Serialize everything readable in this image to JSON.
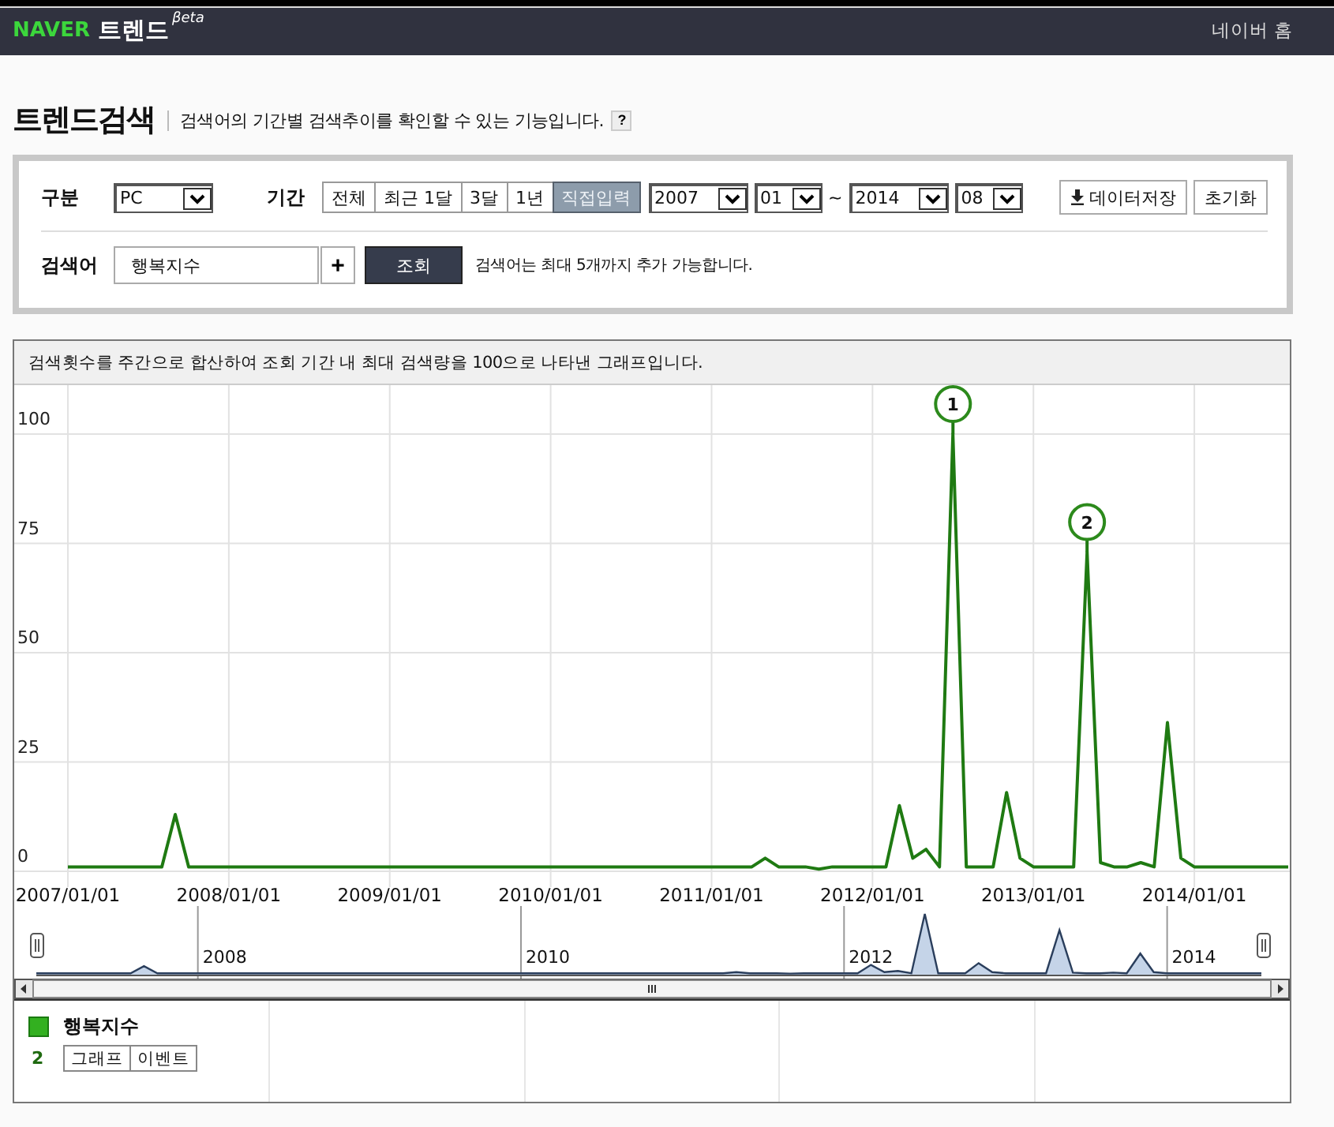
{
  "header": {
    "logo": "NAVER",
    "title": "트렌드",
    "superscript": "βeta",
    "home_link": "네이버 홈"
  },
  "page": {
    "title": "트렌드검색",
    "description": "검색어의 기간별 검색추이를 확인할 수 있는 기능입니다.",
    "help": "?"
  },
  "filters": {
    "category_label": "구분",
    "category": "PC",
    "period_label": "기간",
    "period_tabs": [
      {
        "label": "전체",
        "selected": false
      },
      {
        "label": "최근 1달",
        "selected": false
      },
      {
        "label": "3달",
        "selected": false
      },
      {
        "label": "1년",
        "selected": false
      },
      {
        "label": "직접입력",
        "selected": true
      }
    ],
    "start_year": "2007",
    "start_month": "01",
    "separator": "~",
    "end_year": "2014",
    "end_month": "08",
    "buttons": [
      {
        "kind": "download",
        "label": "데이터저장"
      },
      {
        "kind": "plain",
        "label": "초기화"
      }
    ],
    "keyword_label": "검색어",
    "keyword": "행복지수",
    "add_button": "+",
    "search_button": "조회",
    "hint": "검색어는 최대 5개까지 추가 가능합니다."
  },
  "chart": {
    "caption": "검색횟수를 주간으로 합산하여 조회 기간 내 최대 검색량을 100으로 나타낸 그래프입니다.",
    "chart_data": {
      "type": "line",
      "grid": true,
      "ylim": [
        0,
        100
      ],
      "yticks": [
        0,
        25,
        50,
        75,
        100
      ],
      "categories": [
        "2007/01/01",
        null,
        null,
        null,
        null,
        null,
        null,
        null,
        null,
        null,
        null,
        null,
        "2008/01/01",
        null,
        null,
        null,
        null,
        null,
        null,
        null,
        null,
        null,
        null,
        null,
        "2009/01/01",
        null,
        null,
        null,
        null,
        null,
        null,
        null,
        null,
        null,
        null,
        null,
        "2010/01/01",
        null,
        null,
        null,
        null,
        null,
        null,
        null,
        null,
        null,
        null,
        null,
        "2011/01/01",
        null,
        null,
        null,
        null,
        null,
        null,
        null,
        null,
        null,
        null,
        null,
        "2012/01/01",
        null,
        null,
        null,
        null,
        null,
        null,
        null,
        null,
        null,
        null,
        null,
        "2013/01/01",
        null,
        null,
        null,
        null,
        null,
        null,
        null,
        null,
        null,
        null,
        null,
        "2014/01/01",
        null,
        null,
        null,
        null,
        null,
        null,
        null
      ],
      "series": [
        {
          "name": "행복지수",
          "color": "#1f7a12",
          "values": [
            1,
            1,
            1,
            1,
            1,
            1,
            1,
            1,
            13,
            1,
            1,
            1,
            1,
            1,
            1,
            1,
            1,
            1,
            1,
            1,
            1,
            1,
            1,
            1,
            1,
            1,
            1,
            1,
            1,
            1,
            1,
            1,
            1,
            1,
            1,
            1,
            1,
            1,
            1,
            1,
            1,
            1,
            1,
            1,
            1,
            1,
            1,
            1,
            1,
            1,
            1,
            1,
            3,
            1,
            1,
            1,
            0.5,
            1,
            1,
            1,
            1,
            1,
            15,
            3,
            5,
            1,
            100,
            1,
            1,
            1,
            18,
            3,
            1,
            1,
            1,
            1,
            73,
            2,
            1,
            1,
            2,
            1,
            34,
            3,
            1,
            1,
            1,
            1,
            1,
            1,
            1,
            1
          ]
        }
      ],
      "annotations": [
        {
          "y": 100,
          "text": "1"
        },
        {
          "y": 73,
          "text": "2"
        }
      ]
    }
  },
  "navigator": {
    "labels": [
      "2008",
      "2010",
      "2012",
      "2014"
    ]
  },
  "legend": [
    {
      "color": "#33b020",
      "count": "2",
      "buttons": [
        "그래프",
        "이벤트"
      ]
    }
  ]
}
